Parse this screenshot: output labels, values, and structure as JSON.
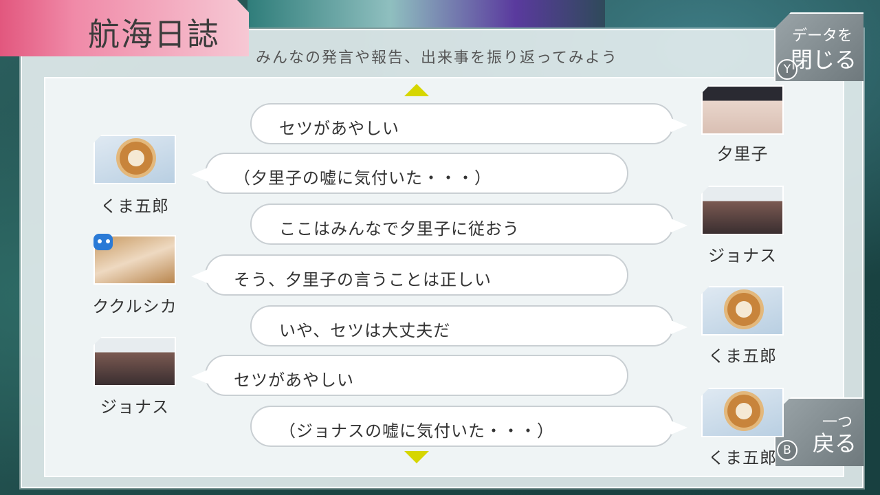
{
  "header": {
    "title": "航海日誌",
    "subtitle": "みんなの発言や報告、出来事を振り返ってみよう"
  },
  "buttons": {
    "close": {
      "line1": "データを",
      "line2": "閉じる",
      "key": "Y"
    },
    "back": {
      "line1": "一つ",
      "line2": "戻る",
      "key": "B"
    }
  },
  "colors": {
    "accent_pink": "#e2577e",
    "scroll_arrow": "#d6d600",
    "speaker_icon": "#2a7ad6"
  },
  "log": [
    {
      "speaker": "夕里子",
      "side": "right",
      "text": "セツがあやしい",
      "portrait": "yuriko-portrait"
    },
    {
      "speaker": "くま五郎",
      "side": "left",
      "text": "（夕里子の嘘に気付いた・・・）",
      "portrait": "kumagoro-sun-icon"
    },
    {
      "speaker": "ジョナス",
      "side": "right",
      "text": "ここはみんなで夕里子に従おう",
      "portrait": "jonas-portrait"
    },
    {
      "speaker": "ククルシカ",
      "side": "left",
      "text": "そう、夕里子の言うことは正しい",
      "portrait": "kukurushka-portrait"
    },
    {
      "speaker": "くま五郎",
      "side": "right",
      "text": "いや、セツは大丈夫だ",
      "portrait": "kumagoro-sun-icon"
    },
    {
      "speaker": "ジョナス",
      "side": "left",
      "text": "セツがあやしい",
      "portrait": "jonas-portrait"
    },
    {
      "speaker": "くま五郎",
      "side": "right",
      "text": "（ジョナスの嘘に気付いた・・・）",
      "portrait": "kumagoro-sun-icon"
    }
  ]
}
